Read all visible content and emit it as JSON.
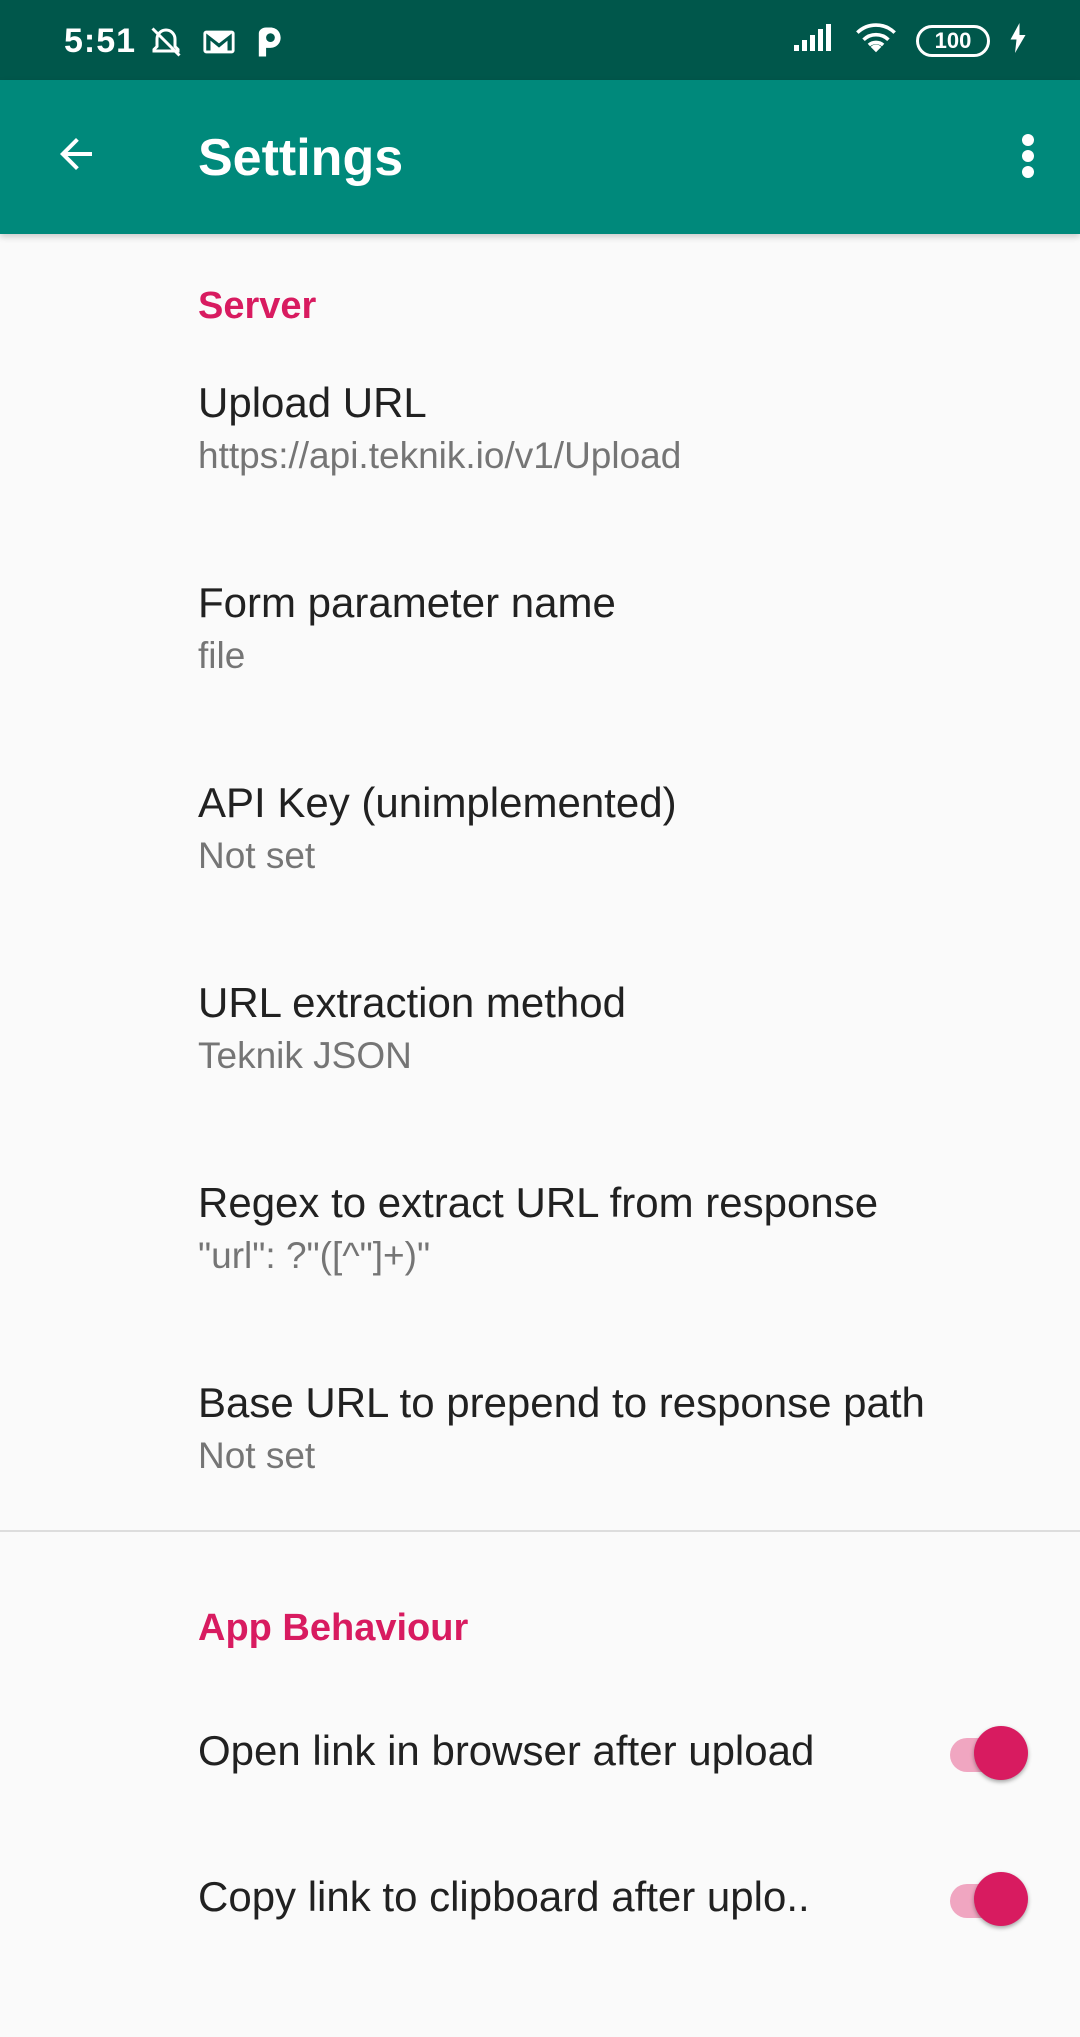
{
  "status_bar": {
    "time": "5:51",
    "battery": "100",
    "icons": [
      "alarm-off-icon",
      "gmail-icon",
      "p-app-icon",
      "signal-icon",
      "wifi-icon",
      "battery-icon",
      "charging-bolt-icon"
    ]
  },
  "app_bar": {
    "title": "Settings",
    "back_icon": "arrow-back-icon",
    "overflow_icon": "more-vert-icon",
    "color": "#00897b"
  },
  "sections": {
    "server": {
      "label": "Server",
      "items": [
        {
          "title": "Upload URL",
          "summary": "https://api.teknik.io/v1/Upload"
        },
        {
          "title": "Form parameter name",
          "summary": "file"
        },
        {
          "title": "API Key (unimplemented)",
          "summary": "Not set"
        },
        {
          "title": "URL extraction method",
          "summary": "Teknik JSON"
        },
        {
          "title": "Regex to extract URL from response",
          "summary": "\"url\": ?\"([^\"]+)\""
        },
        {
          "title": "Base URL to prepend to response path",
          "summary": "Not set"
        }
      ]
    },
    "app_behaviour": {
      "label": "App Behaviour",
      "items": [
        {
          "title": "Open link in browser after upload",
          "checked": true
        },
        {
          "title": "Copy link to clipboard after uplo..",
          "checked": true
        }
      ]
    }
  },
  "colors": {
    "accent": "#d81b60",
    "status_bar": "#00574b",
    "app_bar": "#00897b"
  }
}
